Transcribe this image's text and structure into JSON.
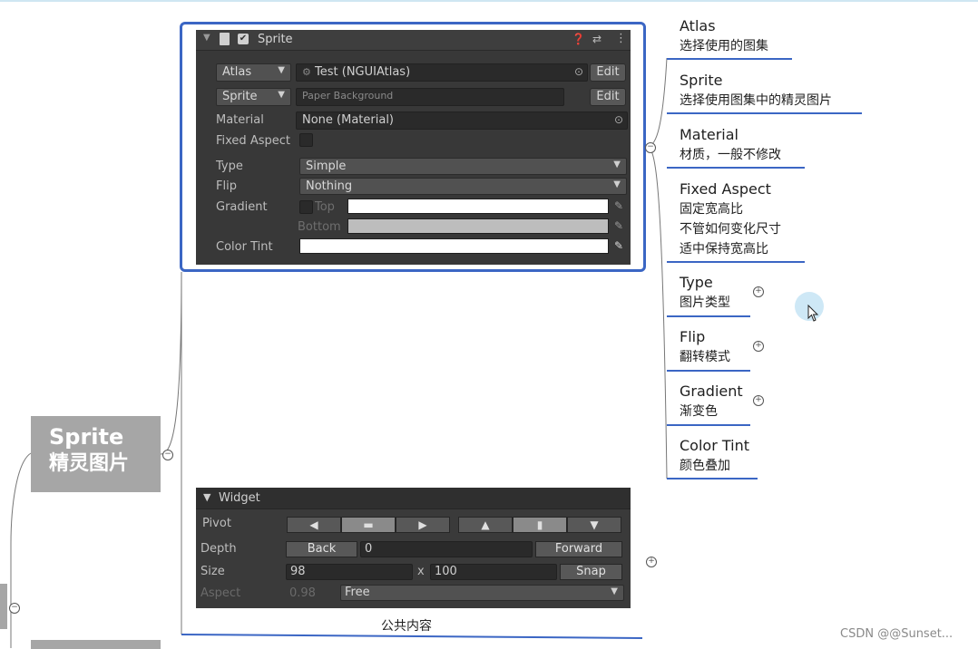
{
  "main_node": {
    "line1": "Sprite",
    "line2": "精灵图片"
  },
  "sprite_panel": {
    "header_title": "Sprite",
    "atlas_dropdown": "Atlas",
    "atlas_value": "Test (NGUIAtlas)",
    "sprite_dropdown": "Sprite",
    "sprite_value": "Paper Background",
    "edit_label": "Edit",
    "material_label": "Material",
    "material_value": "None (Material)",
    "fixed_aspect_label": "Fixed Aspect",
    "type_label": "Type",
    "type_value": "Simple",
    "flip_label": "Flip",
    "flip_value": "Nothing",
    "gradient_label": "Gradient",
    "gradient_top": "Top",
    "gradient_bottom": "Bottom",
    "color_tint_label": "Color Tint"
  },
  "widget_panel": {
    "header": "Widget",
    "pivot_label": "Pivot",
    "depth_label": "Depth",
    "back_label": "Back",
    "depth_value": "0",
    "forward_label": "Forward",
    "size_label": "Size",
    "size_w": "98",
    "size_x": "x",
    "size_h": "100",
    "snap_label": "Snap",
    "aspect_label": "Aspect",
    "aspect_value": "0.98",
    "aspect_mode": "Free"
  },
  "caption": "公共内容",
  "notes": [
    {
      "title": "Atlas",
      "lines": [
        "选择使用的图集"
      ]
    },
    {
      "title": "Sprite",
      "lines": [
        "选择使用图集中的精灵图片"
      ]
    },
    {
      "title": "Material",
      "lines": [
        "材质，一般不修改"
      ]
    },
    {
      "title": "Fixed Aspect",
      "lines": [
        "固定宽高比",
        "不管如何变化尺寸",
        "适中保持宽高比"
      ]
    },
    {
      "title": "Type",
      "lines": [
        "图片类型"
      ]
    },
    {
      "title": "Flip",
      "lines": [
        "翻转模式"
      ]
    },
    {
      "title": "Gradient",
      "lines": [
        "渐变色"
      ]
    },
    {
      "title": "Color Tint",
      "lines": [
        "颜色叠加"
      ]
    }
  ],
  "watermark": "CSDN @@Sunset...",
  "colors": {
    "accent": "#3b66c4",
    "node_gray": "#a6a6a6",
    "panel_bg": "#383838"
  }
}
